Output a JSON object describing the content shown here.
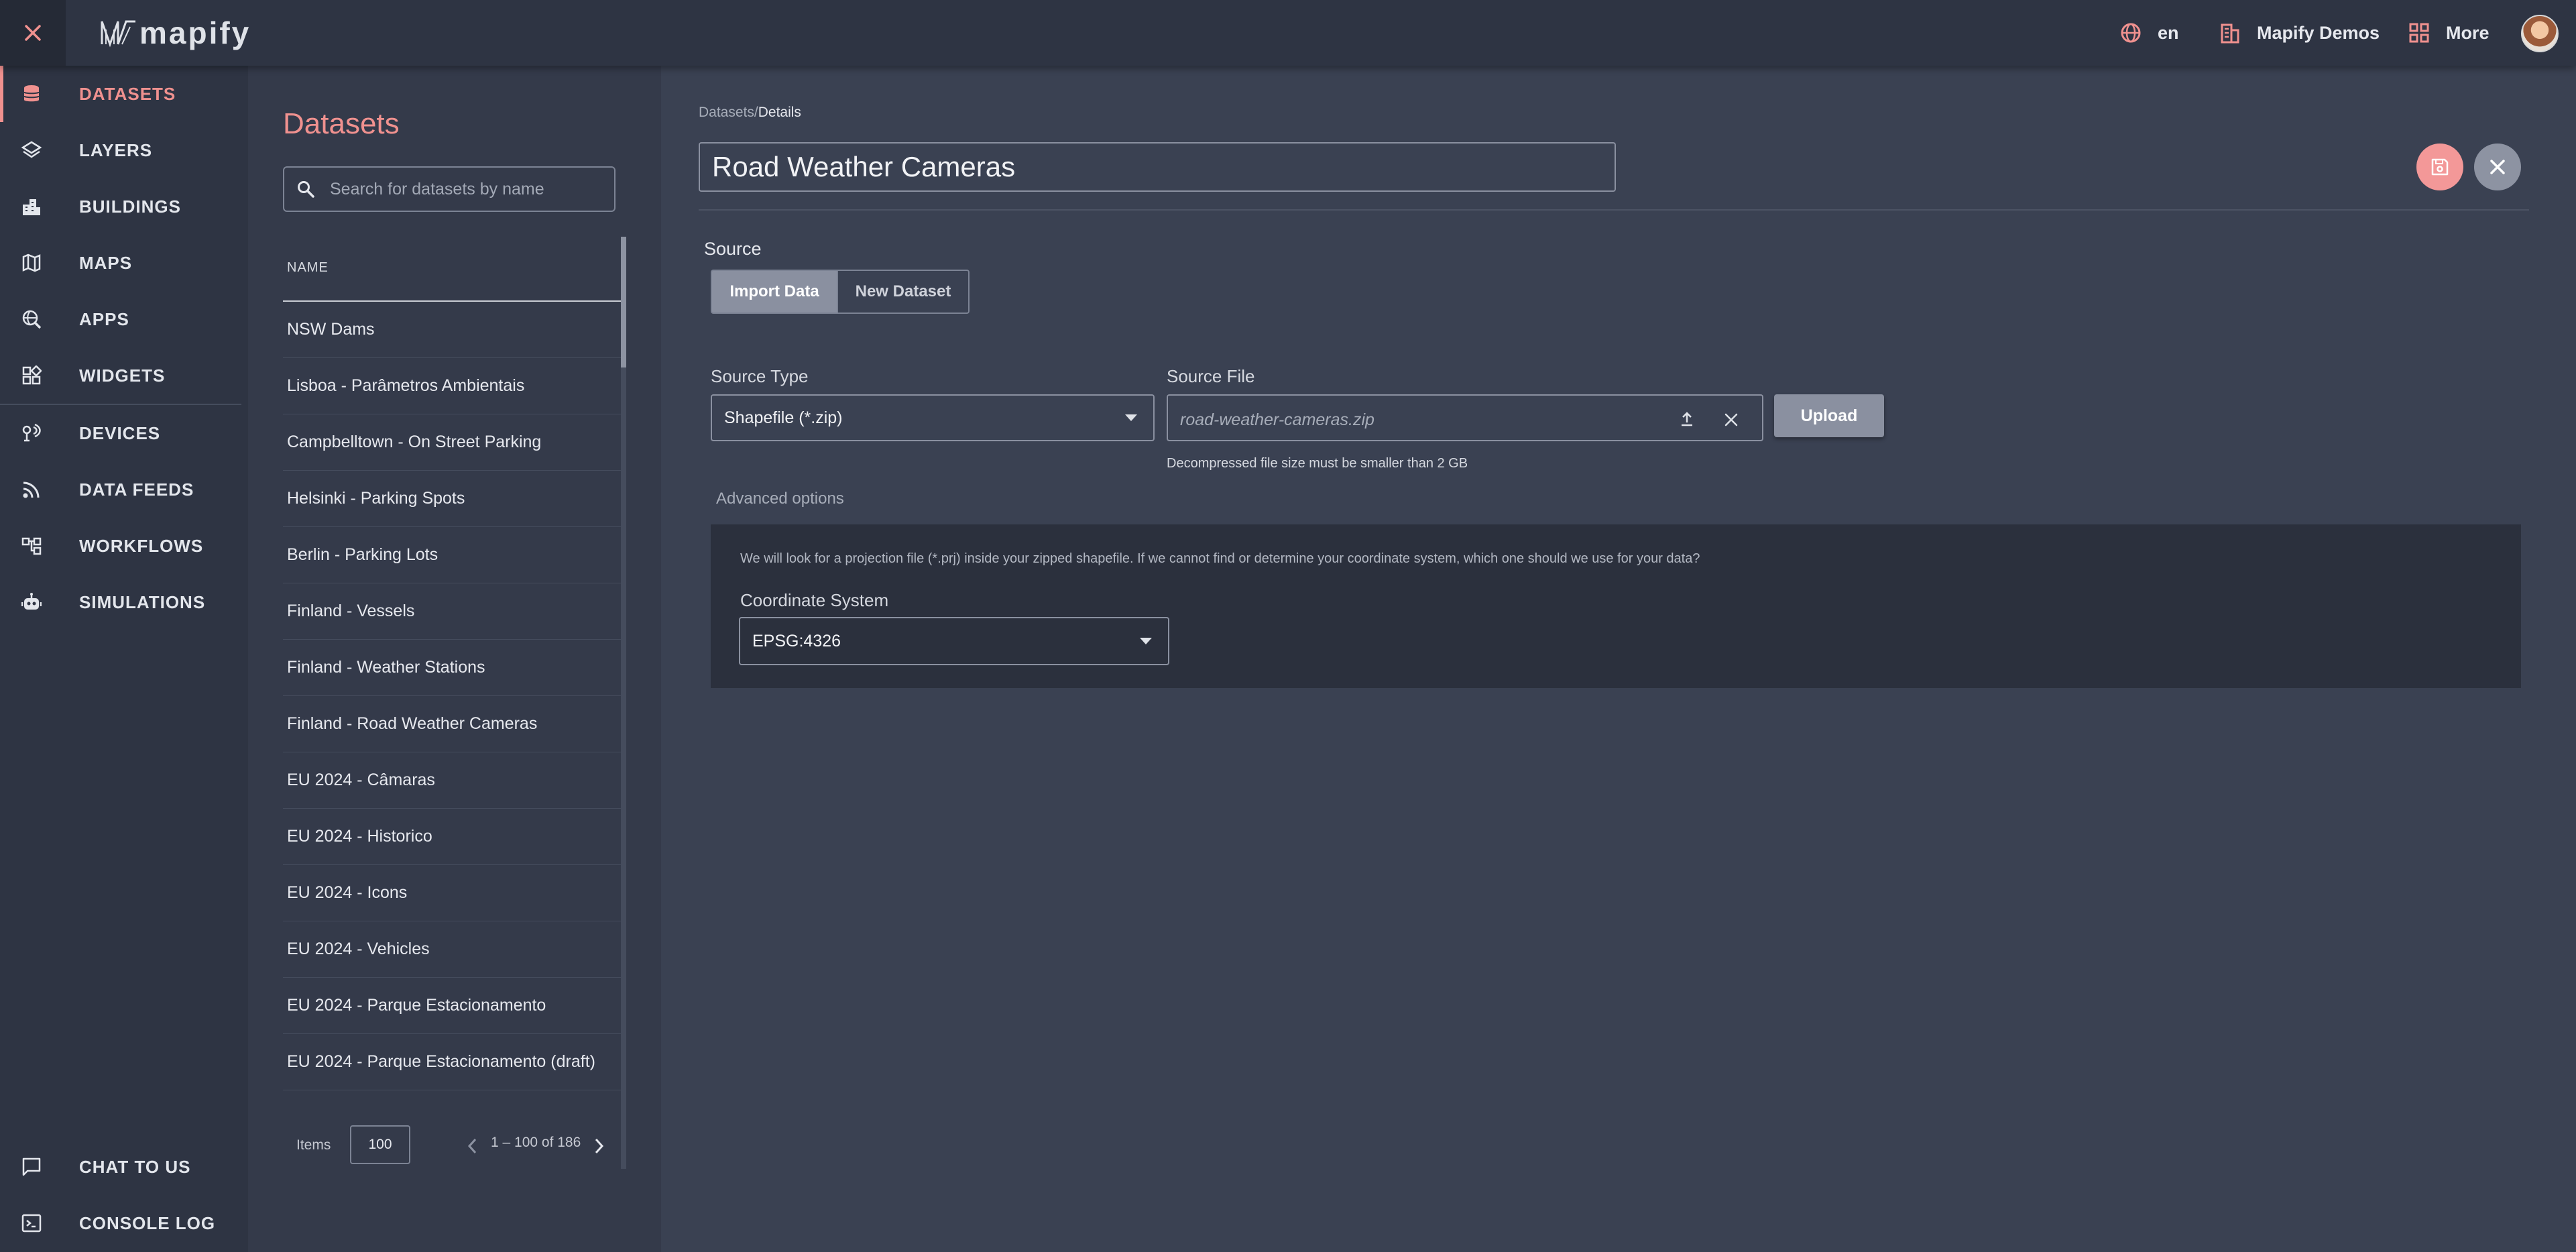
{
  "topbar": {
    "brand": "mapify",
    "language": "en",
    "organization": "Mapify Demos",
    "more": "More"
  },
  "sidebar": {
    "items": [
      {
        "label": "DATASETS",
        "icon": "database-icon",
        "active": true
      },
      {
        "label": "LAYERS",
        "icon": "layers-icon"
      },
      {
        "label": "BUILDINGS",
        "icon": "buildings-icon"
      },
      {
        "label": "MAPS",
        "icon": "map-icon"
      },
      {
        "label": "APPS",
        "icon": "apps-globe-icon"
      },
      {
        "label": "WIDGETS",
        "icon": "widgets-icon"
      },
      {
        "label": "DEVICES",
        "icon": "devices-icon"
      },
      {
        "label": "DATA FEEDS",
        "icon": "rss-feed-icon"
      },
      {
        "label": "WORKFLOWS",
        "icon": "workflow-icon"
      },
      {
        "label": "SIMULATIONS",
        "icon": "robot-icon"
      }
    ],
    "bottom": [
      {
        "label": "CHAT TO US",
        "icon": "chat-icon"
      },
      {
        "label": "CONSOLE LOG",
        "icon": "terminal-icon"
      }
    ],
    "accent_color": "#f0918f"
  },
  "datasets_panel": {
    "title": "Datasets",
    "search_placeholder": "Search for datasets by name",
    "column_header": "NAME",
    "rows": [
      "NSW Dams",
      "Lisboa - Parâmetros Ambientais",
      "Campbelltown - On Street Parking",
      "Helsinki - Parking Spots",
      "Berlin - Parking Lots",
      "Finland - Vessels",
      "Finland - Weather Stations",
      "Finland - Road Weather Cameras",
      "EU 2024 - Câmaras",
      "EU 2024 - Historico",
      "EU 2024 - Icons",
      "EU 2024 - Vehicles",
      "EU 2024 - Parque Estacionamento",
      "EU 2024 - Parque Estacionamento (draft)"
    ],
    "pagination": {
      "items_label": "Items",
      "page_size": "100",
      "range": "1 – 100 of 186"
    }
  },
  "details": {
    "breadcrumb_root": "Datasets",
    "breadcrumb_sep": "/",
    "breadcrumb_current": "Details",
    "name": "Road Weather Cameras",
    "source_label": "Source",
    "source_tabs": [
      "Import Data",
      "New Dataset"
    ],
    "source_type_label": "Source Type",
    "source_type_value": "Shapefile (*.zip)",
    "source_file_label": "Source File",
    "source_file_value": "road-weather-cameras.zip",
    "upload_label": "Upload",
    "file_size_hint": "Decompressed file size must be smaller than 2 GB",
    "advanced_label": "Advanced options",
    "advanced_description": "We will look for a projection file (*.prj) inside your zipped shapefile. If we cannot find or determine your coordinate system, which one should we use for your data?",
    "coordinate_system_label": "Coordinate System",
    "coordinate_system_value": "EPSG:4326"
  },
  "colors": {
    "save_button": "#f39898",
    "close_button": "#8d93a2",
    "panel_bg": "#343a4a",
    "main_bg": "#3a4152"
  }
}
